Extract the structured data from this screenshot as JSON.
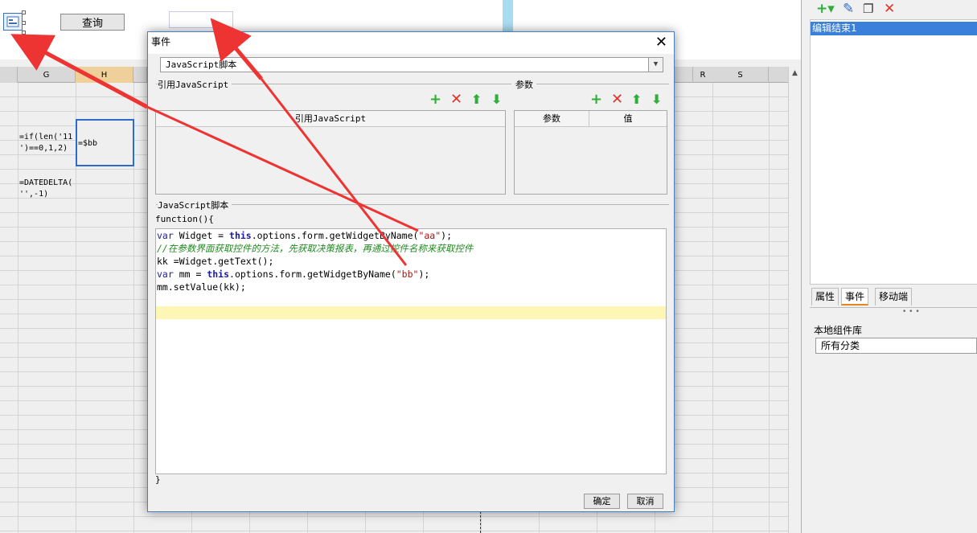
{
  "toolbar": {
    "query_label": "查询"
  },
  "sheet": {
    "columns": [
      "G",
      "H",
      "R",
      "S"
    ],
    "cells": {
      "g_formula_1_line1": "=if(len('11",
      "g_formula_1_line2": "')==0,1,2)",
      "h_value": "=$bb",
      "g_formula_2_line1": "=DATEDELTA(",
      "g_formula_2_line2": "'',-1)"
    }
  },
  "right_panel": {
    "selected_item": "编辑结束1",
    "tabs": [
      "属性",
      "事件",
      "移动端"
    ],
    "active_tab": "事件",
    "library_title": "本地组件库",
    "library_select": "所有分类"
  },
  "dialog": {
    "title": "事件",
    "type_value": "JavaScript脚本",
    "ref_group": "引用JavaScript",
    "params_group": "参数",
    "ref_table_header": "引用JavaScript",
    "params_col_name": "参数",
    "params_col_value": "值",
    "script_group": "JavaScript脚本",
    "fn_open": "function(){",
    "fn_close": "}",
    "ok": "确定",
    "cancel": "取消",
    "code": {
      "line1_kw": "var",
      "line1_a": " Widget = ",
      "line1_this": "this",
      "line1_b": ".options.form.getWidgetByName(",
      "line1_str": "\"aa\"",
      "line1_c": ");",
      "line2": "//在参数界面获取控件的方法，先获取决策报表，再通过控件名称来获取控件",
      "line3": "kk =Widget.getText();",
      "line4_kw": "var",
      "line4_a": " mm = ",
      "line4_this": "this",
      "line4_b": ".options.form.getWidgetByName(",
      "line4_str": "\"bb\"",
      "line4_c": ");",
      "line5": "mm.setValue(kk);"
    }
  },
  "colors": {
    "accent": "#3a7fd9",
    "arrow": "#ee3333",
    "add": "#2fae3a",
    "delete": "#e0332a"
  }
}
